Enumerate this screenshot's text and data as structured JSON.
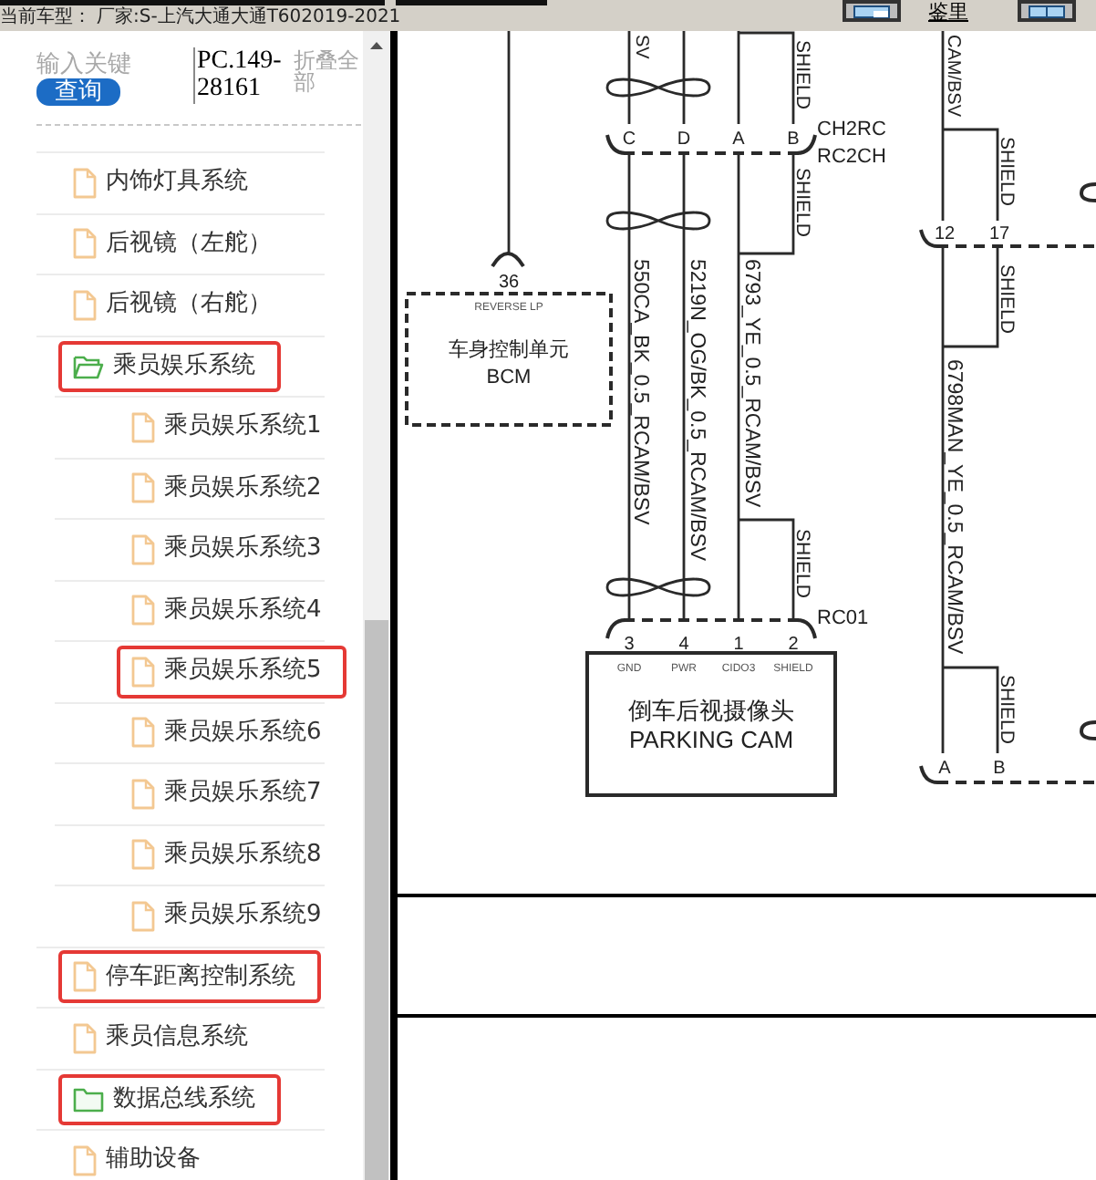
{
  "toolbar": {
    "link": "鉴里"
  },
  "status": {
    "label": "当前车型：",
    "value": "厂家:S-上汽大通大通T602019-2021"
  },
  "search": {
    "placeholder": "输入关键",
    "button": "查询",
    "code": "PC.149-28161",
    "collapse": "折叠全部"
  },
  "tree": [
    {
      "label": "内饰灯具系统",
      "kind": "file",
      "highlighted": false
    },
    {
      "label": "后视镜（左舵）",
      "kind": "file",
      "highlighted": false
    },
    {
      "label": "后视镜（右舵）",
      "kind": "file",
      "highlighted": false
    },
    {
      "label": "乘员娱乐系统",
      "kind": "folder",
      "expanded": true,
      "highlighted": true,
      "children": [
        {
          "label": "乘员娱乐系统1",
          "kind": "file",
          "highlighted": false
        },
        {
          "label": "乘员娱乐系统2",
          "kind": "file",
          "highlighted": false
        },
        {
          "label": "乘员娱乐系统3",
          "kind": "file",
          "highlighted": false
        },
        {
          "label": "乘员娱乐系统4",
          "kind": "file",
          "highlighted": false
        },
        {
          "label": "乘员娱乐系统5",
          "kind": "file",
          "highlighted": true
        },
        {
          "label": "乘员娱乐系统6",
          "kind": "file",
          "highlighted": false
        },
        {
          "label": "乘员娱乐系统7",
          "kind": "file",
          "highlighted": false
        },
        {
          "label": "乘员娱乐系统8",
          "kind": "file",
          "highlighted": false
        },
        {
          "label": "乘员娱乐系统9",
          "kind": "file",
          "highlighted": false
        }
      ]
    },
    {
      "label": "停车距离控制系统",
      "kind": "file",
      "highlighted": true
    },
    {
      "label": "乘员信息系统",
      "kind": "file",
      "highlighted": false
    },
    {
      "label": "数据总线系统",
      "kind": "folder",
      "expanded": false,
      "highlighted": true
    },
    {
      "label": "辅助设备",
      "kind": "file",
      "highlighted": false
    }
  ],
  "diagram": {
    "top_labels": [
      "SV",
      "CAM/BSV"
    ],
    "bcm": {
      "pin": "36",
      "pin_name": "REVERSE LP",
      "name": "车身控制单元",
      "code": "BCM"
    },
    "splice": {
      "pins": [
        "C",
        "D",
        "A",
        "B"
      ],
      "names": [
        "CH2RC",
        "RC2CH"
      ]
    },
    "wire_labels": [
      "550CA_BK_0.5_RCAM/BSV",
      "5219N_OG/BK_0.5_RCAM/BSV",
      "6793_YE_0.5_RCAM/BSV"
    ],
    "shield_labels": [
      "SHIELD",
      "SHIELD",
      "SHIELD",
      "SHIELD",
      "SHIELD",
      "SHIELD"
    ],
    "camera": {
      "connector": "RC01",
      "pins": [
        {
          "number": "3",
          "signal": "GND"
        },
        {
          "number": "4",
          "signal": "PWR"
        },
        {
          "number": "1",
          "signal": "CIDO3"
        },
        {
          "number": "2",
          "signal": "SHIELD"
        }
      ],
      "name": "倒车后视摄像头",
      "code": "PARKING CAM"
    },
    "right": {
      "top_pins": [
        "12",
        "17"
      ],
      "wire_label": "6798MAN_YE_0.5_RCAM/BSV",
      "bottom_pins": [
        "A",
        "B"
      ]
    }
  }
}
